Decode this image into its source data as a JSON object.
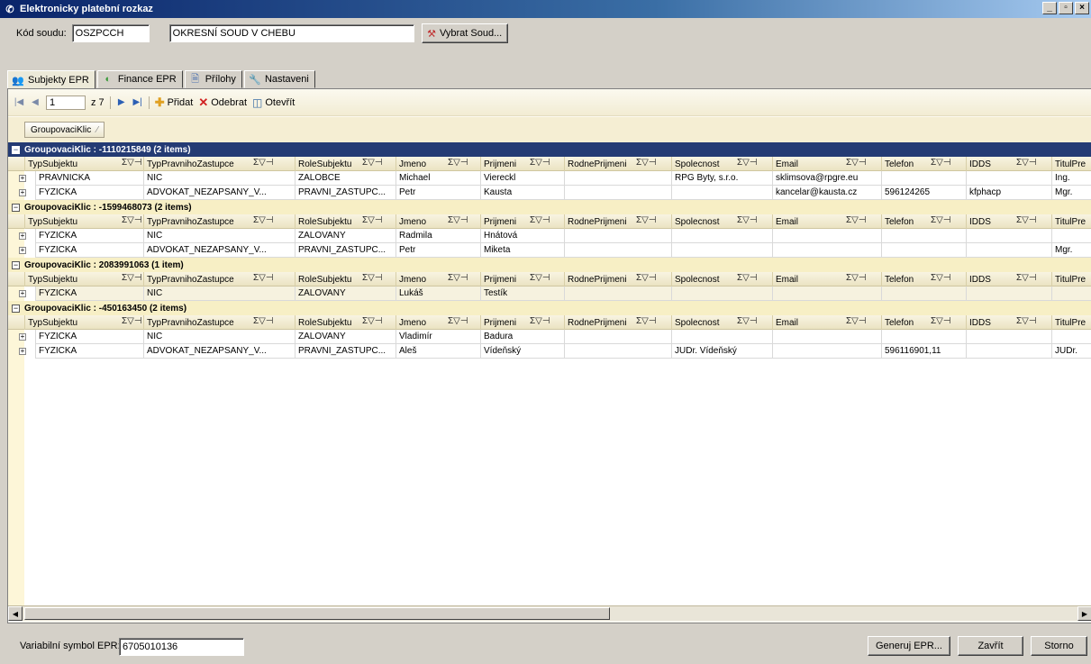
{
  "window": {
    "title": "Elektronicky platební rozkaz",
    "controls": [
      "_",
      "▫",
      "×"
    ]
  },
  "court": {
    "label": "Kód soudu:",
    "code": "OSZPCCH",
    "name": "OKRESNÍ SOUD V CHEBU",
    "select_button": "Vybrat Soud..."
  },
  "tabs": [
    {
      "label": "Subjekty EPR",
      "icon": "people-icon",
      "active": true
    },
    {
      "label": "Finance EPR",
      "icon": "finance-icon",
      "active": false
    },
    {
      "label": "Přílohy",
      "icon": "document-icon",
      "active": false
    },
    {
      "label": "Nastaveni",
      "icon": "wrench-icon",
      "active": false
    }
  ],
  "navigator": {
    "position": "1",
    "of_total": "z 7",
    "add_label": "Přidat",
    "remove_label": "Odebrat",
    "open_label": "Otevřít"
  },
  "grouping": {
    "chip_label": "GroupovaciKlic"
  },
  "columns": [
    "TypSubjektu",
    "TypPravnihoZastupce",
    "RoleSubjektu",
    "Jmeno",
    "Prijmeni",
    "RodnePrijmeni",
    "Spolecnost",
    "Email",
    "Telefon",
    "IDDS",
    "TitulPre"
  ],
  "column_tools": "Σ▽⊣",
  "groups": [
    {
      "header": "GroupovaciKlic : -1110215849 (2 items)",
      "rows": [
        [
          "PRAVNICKA",
          "NIC",
          "ZALOBCE",
          "Michael",
          "Viereckl",
          "",
          "RPG Byty, s.r.o.",
          "sklimsova@rpgre.eu",
          "",
          "",
          "Ing."
        ],
        [
          "FYZICKA",
          "ADVOKAT_NEZAPSANY_V...",
          "PRAVNI_ZASTUPC...",
          "Petr",
          "Kausta",
          "",
          "",
          "kancelar@kausta.cz",
          "596124265",
          "kfphacp",
          "Mgr."
        ]
      ]
    },
    {
      "header": "GroupovaciKlic : -1599468073 (2 items)",
      "rows": [
        [
          "FYZICKA",
          "NIC",
          "ZALOVANY",
          "Radmila",
          "Hnátová",
          "",
          "",
          "",
          "",
          "",
          ""
        ],
        [
          "FYZICKA",
          "ADVOKAT_NEZAPSANY_V...",
          "PRAVNI_ZASTUPC...",
          "Petr",
          "Miketa",
          "",
          "",
          "",
          "",
          "",
          "Mgr."
        ]
      ]
    },
    {
      "header": "GroupovaciKlic : 2083991063 (1 item)",
      "rows": [
        [
          "FYZICKA",
          "NIC",
          "ZALOVANY",
          "Lukáš",
          "Testík",
          "",
          "",
          "",
          "",
          "",
          ""
        ]
      ]
    },
    {
      "header": "GroupovaciKlic : -450163450 (2 items)",
      "rows": [
        [
          "FYZICKA",
          "NIC",
          "ZALOVANY",
          "Vladimír",
          "Badura",
          "",
          "",
          "",
          "",
          "",
          ""
        ],
        [
          "FYZICKA",
          "ADVOKAT_NEZAPSANY_V...",
          "PRAVNI_ZASTUPC...",
          "Aleš",
          "Vídeňský",
          "",
          "JUDr. Vídeňský",
          "",
          "596116901,11",
          "",
          "JUDr."
        ]
      ]
    }
  ],
  "footer": {
    "vs_label": "Variabilní symbol EPR:",
    "vs_value": "6705010136",
    "generate_button": "Generuj EPR...",
    "close_button": "Zavřít",
    "cancel_button": "Storno"
  },
  "colors": {
    "title_bar": "#0a246a",
    "group_header_selected": "#243b74",
    "group_header": "#f7efc5"
  }
}
